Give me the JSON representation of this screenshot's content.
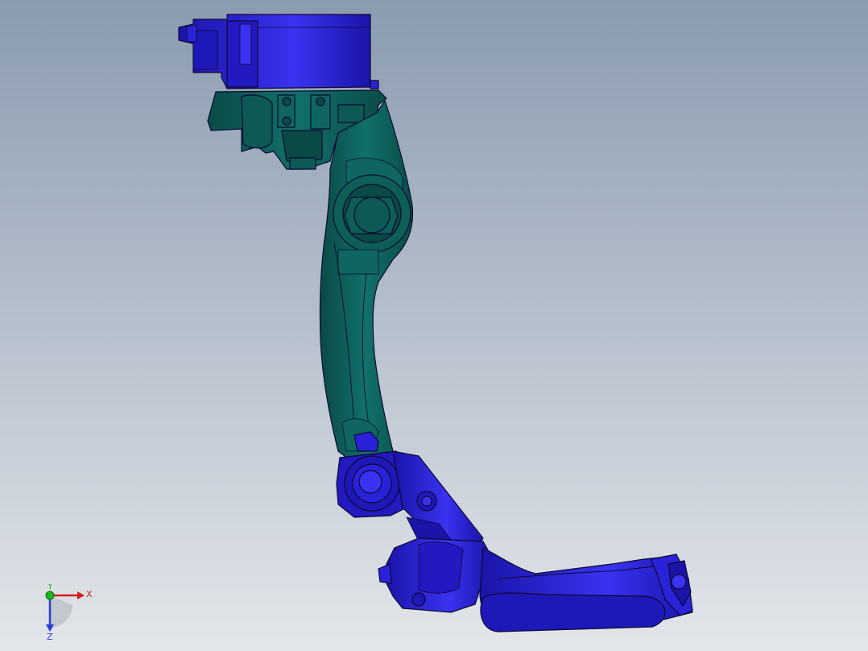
{
  "viewport": {
    "background_top": "#8a9bb0",
    "background_bottom": "#e3e6ea"
  },
  "model": {
    "teal_color": "#0e5e58",
    "teal_shade": "#0a4a46",
    "blue_color": "#2a22d8",
    "blue_shade": "#1a14a8",
    "edge_color": "#0a0a30"
  },
  "triad": {
    "x_label": "X",
    "y_label": "Y",
    "z_label": "Z",
    "x_color": "#d21e1e",
    "y_color": "#1eb41e",
    "z_color": "#2a3ad8"
  }
}
